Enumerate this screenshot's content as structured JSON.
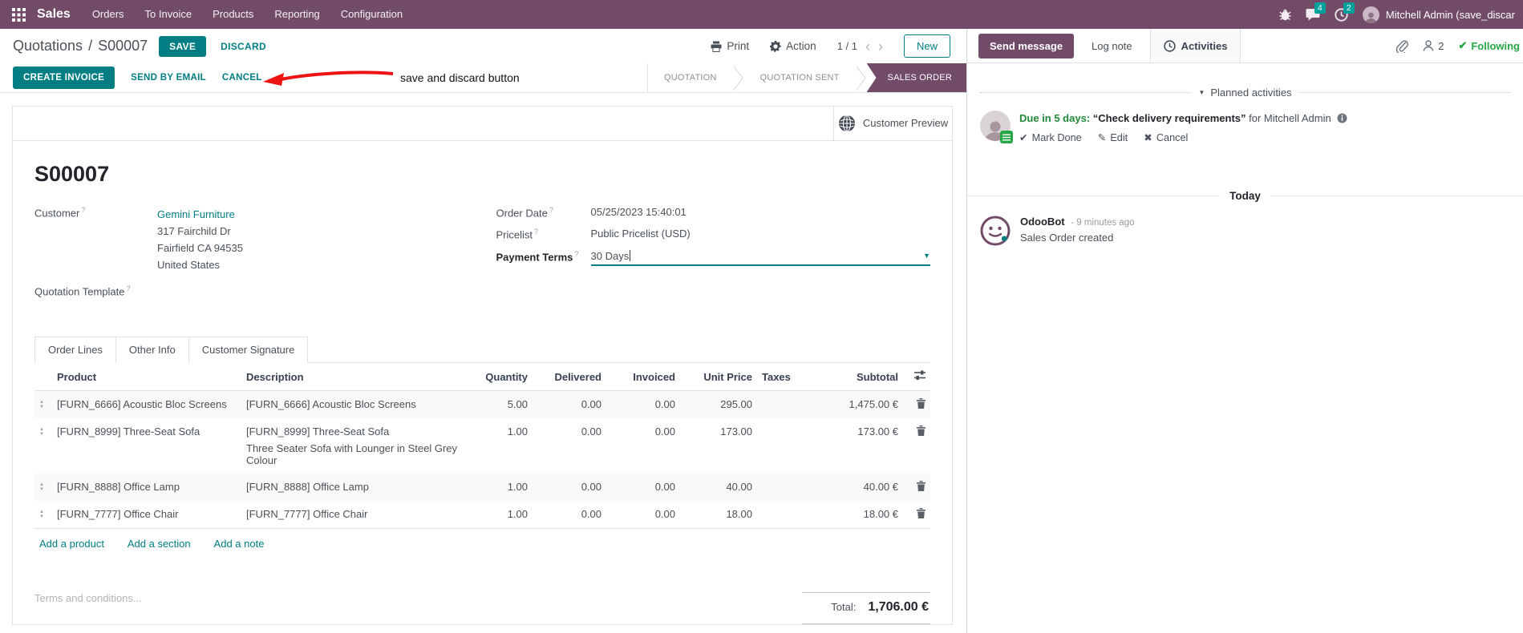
{
  "colors": {
    "navbar_bg": "#714B67",
    "teal": "#017E84",
    "badge_bg": "#00A09D",
    "green": "#28a745",
    "arrow_red": "#ec1313"
  },
  "icons": {
    "check": "✔",
    "pencil": "✎",
    "cross": "✖",
    "caret_down": "▼",
    "triangle_up": "▲",
    "triangle_down": "▼",
    "chevron_left": "‹",
    "chevron_right": "›"
  },
  "navbar": {
    "app_name": "Sales",
    "menus": [
      "Orders",
      "To Invoice",
      "Products",
      "Reporting",
      "Configuration"
    ],
    "messages_badge": "4",
    "activities_badge": "2",
    "user_name": "Mitchell Admin (save_discar"
  },
  "control_panel": {
    "breadcrumb_parent": "Quotations",
    "separator": "/",
    "breadcrumb_current": "S00007",
    "save_label": "SAVE",
    "discard_label": "DISCARD",
    "annotation": "save and discard button",
    "print_label": "Print",
    "action_label": "Action",
    "pager": "1 / 1",
    "new_label": "New"
  },
  "statusbar": {
    "create_invoice": "CREATE INVOICE",
    "send_by_email": "SEND BY EMAIL",
    "cancel": "CANCEL",
    "states": [
      "QUOTATION",
      "QUOTATION SENT",
      "SALES ORDER"
    ],
    "active_state": "SALES ORDER"
  },
  "form": {
    "customer_preview": "Customer Preview",
    "name": "S00007",
    "help_marker": "?",
    "fields": {
      "customer_label": "Customer",
      "customer_value": "Gemini Furniture",
      "address": [
        "317 Fairchild Dr",
        "Fairfield CA 94535",
        "United States"
      ],
      "quotation_template_label": "Quotation Template",
      "order_date_label": "Order Date",
      "order_date_value": "05/25/2023 15:40:01",
      "pricelist_label": "Pricelist",
      "pricelist_value": "Public Pricelist (USD)",
      "payment_terms_label": "Payment Terms",
      "payment_terms_value": "30 Days"
    },
    "tabs": [
      "Order Lines",
      "Other Info",
      "Customer Signature"
    ],
    "table": {
      "headers": [
        "Product",
        "Description",
        "Quantity",
        "Delivered",
        "Invoiced",
        "Unit Price",
        "Taxes",
        "Subtotal"
      ],
      "rows": [
        {
          "product": "[FURN_6666] Acoustic Bloc Screens",
          "description": "[FURN_6666] Acoustic Bloc Screens",
          "description2": "",
          "quantity": "5.00",
          "delivered": "0.00",
          "invoiced": "0.00",
          "unit_price": "295.00",
          "taxes": "",
          "subtotal": "1,475.00 €"
        },
        {
          "product": "[FURN_8999] Three-Seat Sofa",
          "description": "[FURN_8999] Three-Seat Sofa",
          "description2": "Three Seater Sofa with Lounger in Steel Grey Colour",
          "quantity": "1.00",
          "delivered": "0.00",
          "invoiced": "0.00",
          "unit_price": "173.00",
          "taxes": "",
          "subtotal": "173.00 €"
        },
        {
          "product": "[FURN_8888] Office Lamp",
          "description": "[FURN_8888] Office Lamp",
          "description2": "",
          "quantity": "1.00",
          "delivered": "0.00",
          "invoiced": "0.00",
          "unit_price": "40.00",
          "taxes": "",
          "subtotal": "40.00 €"
        },
        {
          "product": "[FURN_7777] Office Chair",
          "description": "[FURN_7777] Office Chair",
          "description2": "",
          "quantity": "1.00",
          "delivered": "0.00",
          "invoiced": "0.00",
          "unit_price": "18.00",
          "taxes": "",
          "subtotal": "18.00 €"
        }
      ],
      "footer_links": [
        "Add a product",
        "Add a section",
        "Add a note"
      ]
    },
    "terms_placeholder": "Terms and conditions...",
    "total_label": "Total:",
    "total_value": "1,706.00 €"
  },
  "chatter": {
    "send_message": "Send message",
    "log_note": "Log note",
    "activities": "Activities",
    "followers_count": "2",
    "following": "Following",
    "planned_header": "Planned activities",
    "activity": {
      "due": "Due in 5 days:",
      "summary": "“Check delivery requirements”",
      "for_user": "for Mitchell Admin",
      "mark_done": "Mark Done",
      "edit": "Edit",
      "cancel": "Cancel"
    },
    "today": "Today",
    "message": {
      "author": "OdooBot",
      "time": "- 9 minutes ago",
      "body": "Sales Order created"
    }
  }
}
